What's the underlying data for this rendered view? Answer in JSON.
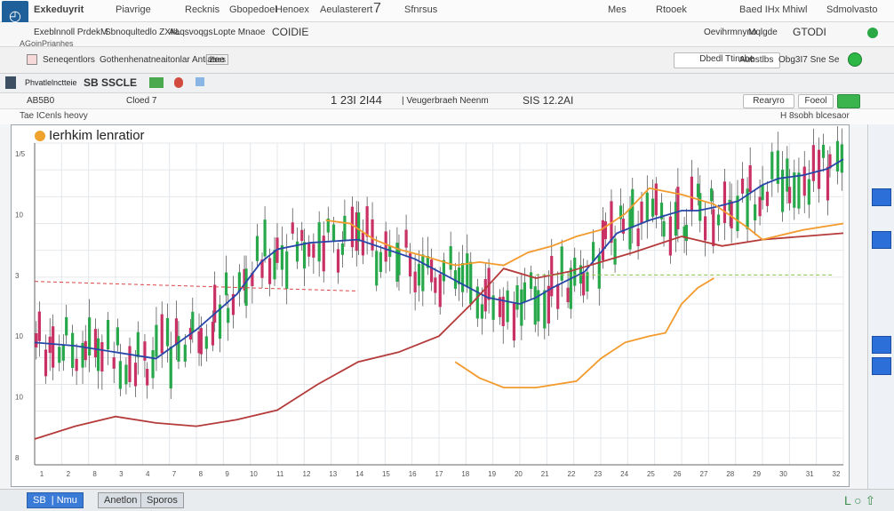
{
  "window": {
    "app_name": "Exkeduyrit",
    "menu": [
      "Piavrige",
      "Recknis",
      "Gbopedoel",
      "Henoex",
      "Aeulasterert",
      "Sfnrsus",
      "Mes",
      "Rtooek",
      "Baed IHx Mhiwl",
      "Sdmolvasto"
    ],
    "menu_number": "7",
    "subbar": [
      "Exeblnnoll PrdekM",
      "Sbnoqultedlo ZXIIL",
      "Aaqsvoqgs",
      "Lopte Mnaoe",
      "COIDIE"
    ],
    "subbar_right": [
      "Oevihrmnyno",
      "Mqlgde",
      "GTODI"
    ],
    "toolbar_left": "AGoinPrianhes",
    "toolbar_label": "Seneqentlors",
    "toolbar_text": "Gothenhenatneaitonlar Antiatee",
    "toolbar_small": "2ses",
    "toolbar_right": [
      "Dbedl Ttinsbe",
      "Aubstlbs",
      "Obg3I7 Sne Se"
    ],
    "quote_left": "Phvatlelnctteie",
    "quote_code": "SB SSCLE",
    "quote_price": "1  23I   2I44",
    "quote_desc": "| Veugerbraeh Neenm",
    "quote_change": "SIS 12.2AI",
    "quote_right": [
      "Rearyro",
      "Foeol"
    ],
    "row4_left": "AB5B0",
    "row4_mid": "Cloed 7",
    "row5_left": "Tae ICenls heovy",
    "row5_right": "H 8sobh blcesaor"
  },
  "chart_data": {
    "type": "line",
    "title": "Ierhkim lenratior",
    "ylabel_ticks": [
      "1/5",
      "10",
      "3",
      "10",
      "10",
      "8"
    ],
    "xlabel_ticks": [
      "1",
      "2",
      "8",
      "3",
      "4",
      "7",
      "8",
      "9",
      "10",
      "11",
      "12",
      "13",
      "14",
      "15",
      "16",
      "17",
      "18",
      "19",
      "20",
      "21",
      "22",
      "23",
      "24",
      "25",
      "26",
      "27",
      "28",
      "29",
      "30",
      "31",
      "32"
    ],
    "ylim": [
      0,
      100
    ],
    "grid": true,
    "colors": {
      "up": "#27a84a",
      "down": "#c93064",
      "blue": "#2746a8",
      "red": "#b53a3a",
      "orange": "#f39a2c"
    },
    "series": [
      {
        "color": "#2746a8",
        "x": [
          0,
          5,
          10,
          15,
          20,
          25,
          28,
          30,
          34,
          40,
          47,
          53,
          56,
          60,
          62,
          64,
          68,
          72,
          76,
          80,
          82,
          84,
          87,
          90,
          92,
          95,
          98,
          100
        ],
        "values": [
          38,
          37,
          35,
          33,
          42,
          53,
          63,
          67,
          69,
          70,
          64,
          56,
          52,
          50,
          52,
          55,
          60,
          72,
          76,
          79,
          79,
          80,
          82,
          87,
          89,
          90,
          92,
          95
        ]
      },
      {
        "color": "#b53a3a",
        "x": [
          0,
          5,
          10,
          15,
          20,
          25,
          30,
          35,
          40,
          45,
          50,
          54,
          58,
          62,
          66,
          70,
          74,
          80,
          85,
          90,
          95,
          100
        ],
        "values": [
          8,
          12,
          15,
          13,
          12,
          14,
          17,
          25,
          32,
          35,
          40,
          50,
          61,
          58,
          60,
          63,
          66,
          71,
          68,
          70,
          71,
          72
        ]
      },
      {
        "color": "#f39a2c",
        "x": [
          36,
          39,
          42,
          45,
          48,
          52,
          55,
          58,
          61,
          64,
          67,
          70,
          73,
          76,
          80,
          84,
          88,
          90,
          95,
          100
        ],
        "values": [
          76,
          75,
          70,
          67,
          65,
          62,
          63,
          62,
          66,
          68,
          71,
          73,
          78,
          86,
          84,
          81,
          74,
          70,
          73,
          75
        ]
      },
      {
        "color": "#f39a2c",
        "x": [
          52,
          55,
          58,
          62,
          67,
          70,
          73,
          76,
          78,
          80,
          82,
          84
        ],
        "values": [
          32,
          27,
          24,
          24,
          26,
          33,
          38,
          40,
          41,
          50,
          55,
          58
        ]
      }
    ]
  }
}
